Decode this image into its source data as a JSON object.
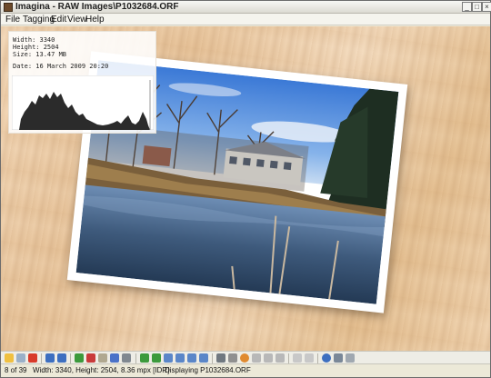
{
  "window": {
    "title": "Imagina - RAW Images\\P1032684.ORF"
  },
  "menu": [
    "File",
    "Tagging",
    "Edit",
    "View",
    "Help"
  ],
  "info": {
    "width": "Width: 3340",
    "height": "Height: 2504",
    "size": "Size: 13.47 MB",
    "date": "Date: 16 March 2009 20:20"
  },
  "status": {
    "counter": "8 of 39",
    "dimensions": "Width: 3340, Height: 2504, 8.36 mpx [IDR]",
    "message": "Displaying P1032684.ORF"
  },
  "toolbar_icons": [
    "open-icon",
    "save-icon",
    "delete-icon",
    "prev-icon",
    "next-icon",
    "tag-green-icon",
    "tag-red-icon",
    "text-icon",
    "bold-icon",
    "image-icon",
    "rotate-left-icon",
    "rotate-right-icon",
    "fit-icon",
    "zoom-icon",
    "crop-icon",
    "resize-icon",
    "copy-icon",
    "print-icon",
    "color-icon",
    "undo-icon",
    "redo-icon",
    "refresh-icon",
    "slideshow-icon",
    "settings-icon",
    "info-icon",
    "tools-icon",
    "view-mode-icon"
  ],
  "colors": {
    "accent": "#2d6cc0",
    "wood": "#ecc9a0"
  }
}
